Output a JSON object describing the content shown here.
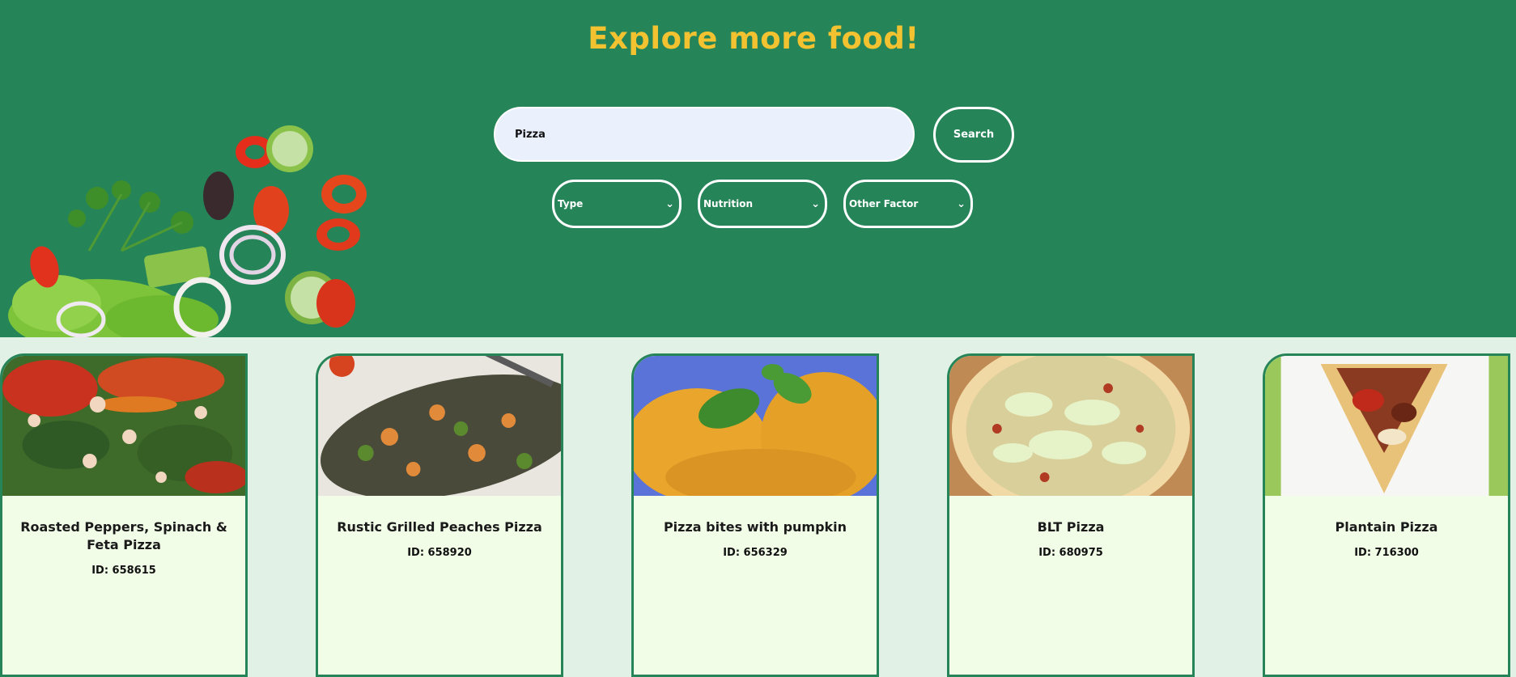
{
  "header": {
    "title": "Explore more food!"
  },
  "search": {
    "value": "Pizza",
    "button_label": "Search"
  },
  "filters": [
    {
      "label": "Type"
    },
    {
      "label": "Nutrition"
    },
    {
      "label": "Other Factor"
    }
  ],
  "recipes": [
    {
      "name": "Roasted Peppers, Spinach & Feta Pizza",
      "id": "ID: 658615"
    },
    {
      "name": "Rustic Grilled Peaches Pizza",
      "id": "ID: 658920"
    },
    {
      "name": "Pizza bites with pumpkin",
      "id": "ID: 656329"
    },
    {
      "name": "BLT Pizza",
      "id": "ID: 680975"
    },
    {
      "name": "Plantain Pizza",
      "id": "ID: 716300"
    }
  ],
  "colors": {
    "hero_bg": "#268558",
    "title": "#f2c230",
    "card_bg": "#f2fde8",
    "page_bg": "#e2f1e6"
  }
}
